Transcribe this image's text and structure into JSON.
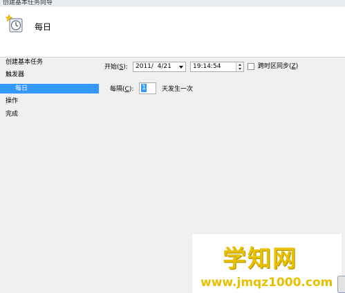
{
  "window": {
    "title": "创建基本任务向导"
  },
  "header": {
    "title": "每日",
    "icon": "scheduled-task-clock-icon"
  },
  "sidebar": {
    "items": [
      {
        "label": "创建基本任务"
      },
      {
        "label": "触发器"
      },
      {
        "label": "每日",
        "selected": true
      },
      {
        "label": "操作"
      },
      {
        "label": "完成"
      }
    ]
  },
  "trigger": {
    "start_label": "开始(",
    "start_key": "S",
    "start_close": "):",
    "date_value": "2011/  4/21",
    "time_value": "19:14:54",
    "sync_label": "跨时区同步(",
    "sync_key": "Z",
    "sync_close": ")",
    "sync_checked": false,
    "recur_label": "每隔(",
    "recur_key": "C",
    "recur_close": "):",
    "recur_value": "1",
    "recur_suffix": "天发生一次"
  },
  "watermark": {
    "title": "学知网",
    "url": "www.jmqz1000.com"
  },
  "colors": {
    "selection": "#3399ff",
    "watermark": "#e8c000"
  }
}
